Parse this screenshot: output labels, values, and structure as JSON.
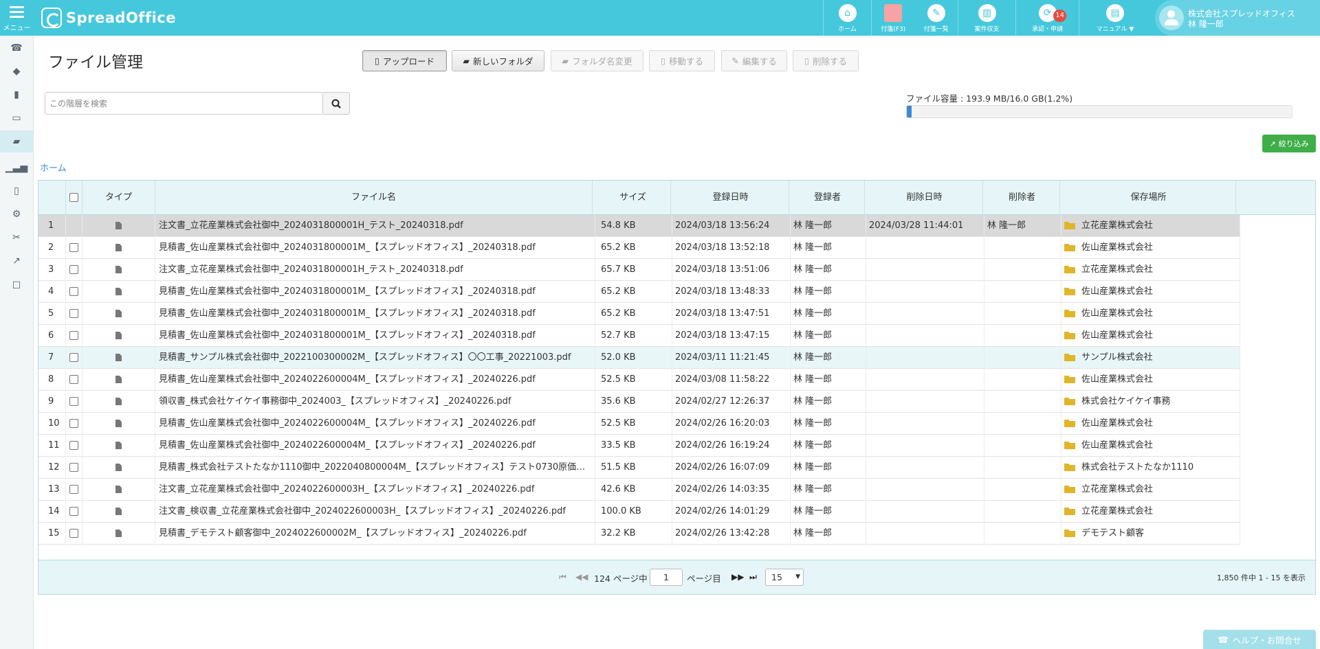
{
  "app": {
    "menu_label": "メニュー",
    "logo_text": "SpreadOffice"
  },
  "topnav": [
    {
      "label": "ホーム",
      "icon": "home-icon"
    },
    {
      "label": "付箋(F3)",
      "icon": "sticky-note-icon"
    },
    {
      "label": "付箋一覧",
      "icon": "pin-icon"
    },
    {
      "label": "案件収支",
      "icon": "bar-chart-icon"
    },
    {
      "label": "承認・申請",
      "icon": "retweet-icon",
      "badge": "14"
    },
    {
      "label": "マニュアル ▼",
      "icon": "book-icon"
    }
  ],
  "user": {
    "company": "株式会社スプレッドオフィス",
    "name": "林 隆一郎"
  },
  "sidebar": [
    "phone-icon",
    "tags-icon",
    "bar-chart-icon",
    "card-icon",
    "folder-open-icon",
    "signal-icon",
    "file-icon",
    "gear-icon",
    "wrench-icon",
    "external-link-icon",
    "square-icon"
  ],
  "page": {
    "title": "ファイル管理"
  },
  "toolbar": {
    "upload": "アップロード",
    "new_folder": "新しいフォルダ",
    "rename_folder": "フォルダ名変更",
    "move": "移動する",
    "edit": "編集する",
    "delete": "削除する"
  },
  "search": {
    "placeholder": "この階層を検索"
  },
  "capacity": {
    "label": "ファイル容量 : 193.9 MB/16.0 GB(1.2%)",
    "percent": 1.2
  },
  "filter": {
    "label": "絞り込み"
  },
  "breadcrumb": {
    "home": "ホーム"
  },
  "table": {
    "headers": {
      "type": "タイプ",
      "name": "ファイル名",
      "size": "サイズ",
      "registered": "登録日時",
      "registrant": "登録者",
      "deleted_at": "削除日時",
      "deleted_by": "削除者",
      "location": "保存場所"
    },
    "rows": [
      {
        "no": "1",
        "name": "注文書_立花産業株式会社御中_2024031800001H_テスト_20240318.pdf",
        "size": "54.8 KB",
        "date": "2024/03/18 13:56:24",
        "user": "林 隆一郎",
        "del_date": "2024/03/28 11:44:01",
        "del_user": "林 隆一郎",
        "loc": "立花産業株式会社"
      },
      {
        "no": "2",
        "name": "見積書_佐山産業株式会社御中_2024031800001M_【スプレッドオフィス】_20240318.pdf",
        "size": "65.2 KB",
        "date": "2024/03/18 13:52:18",
        "user": "林 隆一郎",
        "del_date": "",
        "del_user": "",
        "loc": "佐山産業株式会社"
      },
      {
        "no": "3",
        "name": "注文書_立花産業株式会社御中_2024031800001H_テスト_20240318.pdf",
        "size": "65.7 KB",
        "date": "2024/03/18 13:51:06",
        "user": "林 隆一郎",
        "del_date": "",
        "del_user": "",
        "loc": "立花産業株式会社"
      },
      {
        "no": "4",
        "name": "見積書_佐山産業株式会社御中_2024031800001M_【スプレッドオフィス】_20240318.pdf",
        "size": "65.2 KB",
        "date": "2024/03/18 13:48:33",
        "user": "林 隆一郎",
        "del_date": "",
        "del_user": "",
        "loc": "佐山産業株式会社"
      },
      {
        "no": "5",
        "name": "見積書_佐山産業株式会社御中_2024031800001M_【スプレッドオフィス】_20240318.pdf",
        "size": "65.2 KB",
        "date": "2024/03/18 13:47:51",
        "user": "林 隆一郎",
        "del_date": "",
        "del_user": "",
        "loc": "佐山産業株式会社"
      },
      {
        "no": "6",
        "name": "見積書_佐山産業株式会社御中_2024031800001M_【スプレッドオフィス】_20240318.pdf",
        "size": "52.7 KB",
        "date": "2024/03/18 13:47:15",
        "user": "林 隆一郎",
        "del_date": "",
        "del_user": "",
        "loc": "佐山産業株式会社"
      },
      {
        "no": "7",
        "name": "見積書_サンプル株式会社御中_2022100300002M_【スプレッドオフィス】〇〇工事_20221003.pdf",
        "size": "52.0 KB",
        "date": "2024/03/11 11:21:45",
        "user": "林 隆一郎",
        "del_date": "",
        "del_user": "",
        "loc": "サンプル株式会社"
      },
      {
        "no": "8",
        "name": "見積書_佐山産業株式会社御中_2024022600004M_【スプレッドオフィス】_20240226.pdf",
        "size": "52.5 KB",
        "date": "2024/03/08 11:58:22",
        "user": "林 隆一郎",
        "del_date": "",
        "del_user": "",
        "loc": "佐山産業株式会社"
      },
      {
        "no": "9",
        "name": "領収書_株式会社ケイケイ事務御中_2024003_【スプレッドオフィス】_20240226.pdf",
        "size": "35.6 KB",
        "date": "2024/02/27 12:26:37",
        "user": "林 隆一郎",
        "del_date": "",
        "del_user": "",
        "loc": "株式会社ケイケイ事務"
      },
      {
        "no": "10",
        "name": "見積書_佐山産業株式会社御中_2024022600004M_【スプレッドオフィス】_20240226.pdf",
        "size": "52.5 KB",
        "date": "2024/02/26 16:20:03",
        "user": "林 隆一郎",
        "del_date": "",
        "del_user": "",
        "loc": "佐山産業株式会社"
      },
      {
        "no": "11",
        "name": "見積書_佐山産業株式会社御中_2024022600004M_【スプレッドオフィス】_20240226.pdf",
        "size": "33.5 KB",
        "date": "2024/02/26 16:19:24",
        "user": "林 隆一郎",
        "del_date": "",
        "del_user": "",
        "loc": "佐山産業株式会社"
      },
      {
        "no": "12",
        "name": "見積書_株式会社テストたなか1110御中_2022040800004M_【スプレッドオフィス】テスト0730原価…",
        "size": "51.5 KB",
        "date": "2024/02/26 16:07:09",
        "user": "林 隆一郎",
        "del_date": "",
        "del_user": "",
        "loc": "株式会社テストたなか1110"
      },
      {
        "no": "13",
        "name": "注文書_立花産業株式会社御中_2024022600003H_【スプレッドオフィス】_20240226.pdf",
        "size": "42.6 KB",
        "date": "2024/02/26 14:03:35",
        "user": "林 隆一郎",
        "del_date": "",
        "del_user": "",
        "loc": "立花産業株式会社"
      },
      {
        "no": "14",
        "name": "注文書_検収書_立花産業株式会社御中_2024022600003H_【スプレッドオフィス】_20240226.pdf",
        "size": "100.0 KB",
        "date": "2024/02/26 14:01:29",
        "user": "林 隆一郎",
        "del_date": "",
        "del_user": "",
        "loc": "立花産業株式会社"
      },
      {
        "no": "15",
        "name": "見積書_デモテスト顧客御中_2024022600002M_【スプレッドオフィス】_20240226.pdf",
        "size": "32.2 KB",
        "date": "2024/02/26 13:42:28",
        "user": "林 隆一郎",
        "del_date": "",
        "del_user": "",
        "loc": "デモテスト顧客"
      }
    ]
  },
  "pager": {
    "total_pages_label": "124 ページ中",
    "current_page": "1",
    "page_suffix": "ページ目",
    "per_page": "15",
    "count_label": "1,850 件中 1 - 15 を表示"
  },
  "help": {
    "label": "ヘルプ・お問合せ"
  },
  "colors": {
    "topbar": "#45c8dc",
    "accent_blue": "#3d8bd0",
    "filter_green": "#3fae49",
    "folder": "#e0b52a",
    "badge": "#e84c3d"
  }
}
